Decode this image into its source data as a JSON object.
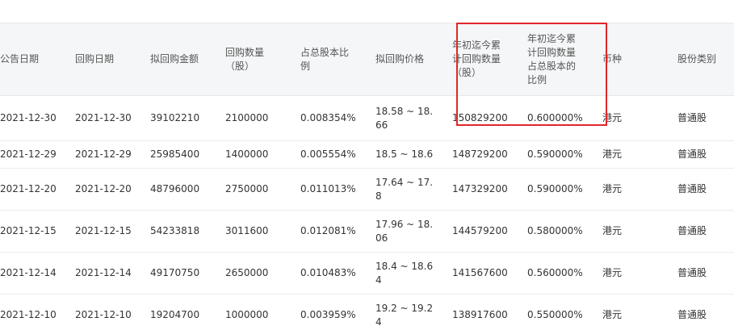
{
  "table": {
    "headers": [
      "公告日期",
      "回购日期",
      "拟回购金额",
      "回购数量\n（股）",
      "占总股本比\n例",
      "拟回购价格",
      "年初迄今累\n计回购数量\n（股）",
      "年初迄今累\n计回购数量\n占总股本的\n比例",
      "币种",
      "股份类别"
    ],
    "rows": [
      [
        "2021-12-30",
        "2021-12-30",
        "39102210",
        "2100000",
        "0.008354%",
        "18.58 ~ 18.\n66",
        "150829200",
        "0.600000%",
        "港元",
        "普通股"
      ],
      [
        "2021-12-29",
        "2021-12-29",
        "25985400",
        "1400000",
        "0.005554%",
        "18.5 ~ 18.6",
        "148729200",
        "0.590000%",
        "港元",
        "普通股"
      ],
      [
        "2021-12-20",
        "2021-12-20",
        "48796000",
        "2750000",
        "0.011013%",
        "17.64 ~ 17.\n8",
        "147329200",
        "0.590000%",
        "港元",
        "普通股"
      ],
      [
        "2021-12-15",
        "2021-12-15",
        "54233818",
        "3011600",
        "0.012081%",
        "17.96 ~ 18.\n06",
        "144579200",
        "0.580000%",
        "港元",
        "普通股"
      ],
      [
        "2021-12-14",
        "2021-12-14",
        "49170750",
        "2650000",
        "0.010483%",
        "18.4 ~ 18.6\n4",
        "141567600",
        "0.560000%",
        "港元",
        "普通股"
      ],
      [
        "2021-12-10",
        "2021-12-10",
        "19204700",
        "1000000",
        "0.003959%",
        "19.2 ~ 19.2\n4",
        "138917600",
        "0.550000%",
        "港元",
        "普通股"
      ]
    ]
  },
  "highlight": {
    "color": "#e0262b",
    "columns": [
      "年初迄今累计回购数量（股）",
      "年初迄今累计回购数量占总股本的比例"
    ]
  }
}
